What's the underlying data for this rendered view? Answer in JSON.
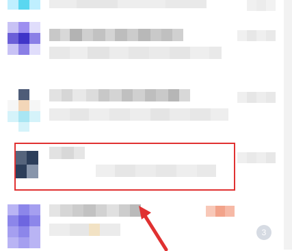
{
  "chat_list": {
    "items": [
      {
        "name": "",
        "preview": "",
        "time": "",
        "unread_count": "",
        "avatar_colors": [
          "#5ad7f0",
          "#bfefff",
          "#e9fbff"
        ]
      },
      {
        "name": "",
        "preview": "",
        "time": "",
        "unread_count": "",
        "avatar_colors": [
          "#9d8ff0",
          "#6b5fd8",
          "#3f34c8",
          "#c8c2f5",
          "#8a7fe6",
          "#e0ddfb"
        ]
      },
      {
        "name": "",
        "preview": "",
        "time": "",
        "unread_count": "",
        "avatar_colors": [
          "#4e5c78",
          "#f3d6b8",
          "#a9e6f3",
          "#d5f3fa"
        ]
      },
      {
        "name": "",
        "preview": "",
        "time": "",
        "unread_count": "",
        "avatar_colors": [
          "#2c3e5a",
          "#8795ab",
          "#ffffff",
          "#55647c"
        ],
        "highlighted": true
      },
      {
        "name": "",
        "preview": "",
        "time": "",
        "unread_count": "3",
        "avatar_colors": [
          "#8c86ea",
          "#6e66e0",
          "#b9b4f4",
          "#a59ff0"
        ]
      }
    ]
  },
  "annotation": {
    "box_color": "#e03131",
    "arrow_color": "#e03131"
  },
  "colors": {
    "mosaic_gray_light": "#e6e6e6",
    "mosaic_gray_mid": "#c4c4c4",
    "mosaic_gray_dark": "#9a9a9a",
    "accent_orange": "#f2a38a"
  }
}
